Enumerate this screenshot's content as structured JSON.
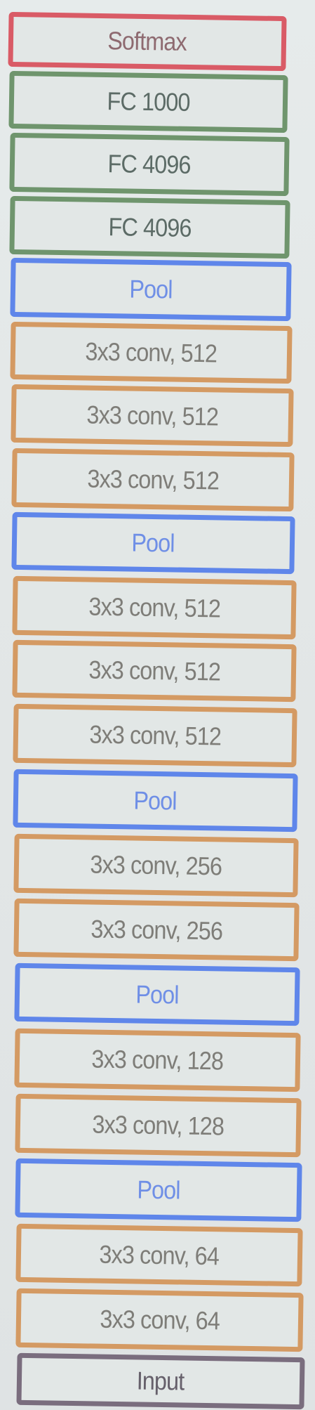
{
  "layers": [
    {
      "label": "Softmax",
      "kind": "softmax"
    },
    {
      "label": "FC 1000",
      "kind": "fc"
    },
    {
      "label": "FC 4096",
      "kind": "fc"
    },
    {
      "label": "FC 4096",
      "kind": "fc"
    },
    {
      "label": "Pool",
      "kind": "pool"
    },
    {
      "label": "3x3 conv, 512",
      "kind": "conv"
    },
    {
      "label": "3x3 conv, 512",
      "kind": "conv"
    },
    {
      "label": "3x3 conv, 512",
      "kind": "conv"
    },
    {
      "label": "Pool",
      "kind": "pool"
    },
    {
      "label": "3x3 conv, 512",
      "kind": "conv"
    },
    {
      "label": "3x3 conv, 512",
      "kind": "conv"
    },
    {
      "label": "3x3 conv, 512",
      "kind": "conv"
    },
    {
      "label": "Pool",
      "kind": "pool"
    },
    {
      "label": "3x3 conv, 256",
      "kind": "conv"
    },
    {
      "label": "3x3 conv, 256",
      "kind": "conv"
    },
    {
      "label": "Pool",
      "kind": "pool"
    },
    {
      "label": "3x3 conv, 128",
      "kind": "conv"
    },
    {
      "label": "3x3 conv, 128",
      "kind": "conv"
    },
    {
      "label": "Pool",
      "kind": "pool"
    },
    {
      "label": "3x3 conv, 64",
      "kind": "conv"
    },
    {
      "label": "3x3 conv, 64",
      "kind": "conv"
    },
    {
      "label": "Input",
      "kind": "input"
    }
  ]
}
